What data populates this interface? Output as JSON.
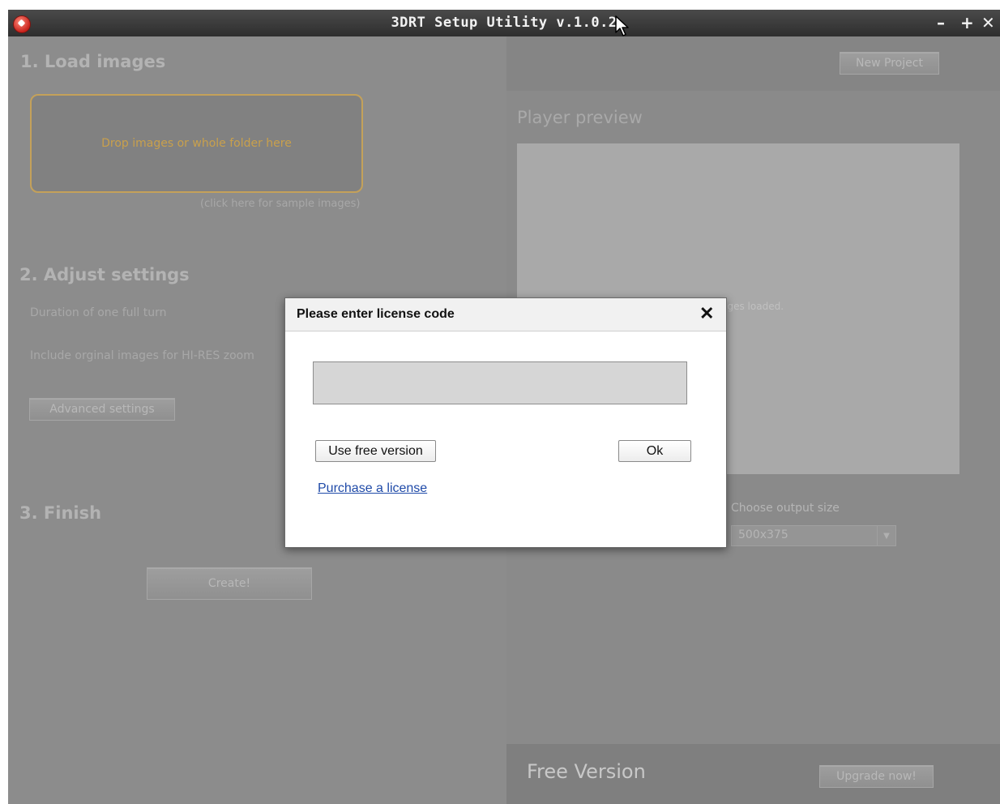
{
  "window": {
    "title": "3DRT Setup Utility v.1.0.2",
    "controls": {
      "minimize": "–",
      "maximize": "+",
      "close": "✕"
    }
  },
  "left": {
    "section1_title": "1. Load images",
    "drop_zone_text": "Drop images or whole folder here",
    "sample_link": "(click here for sample images)",
    "section2_title": "2. Adjust settings",
    "duration_label": "Duration of one full turn",
    "include_label": "Include orginal images for HI-RES zoom",
    "advanced_button": "Advanced settings",
    "section3_title": "3. Finish",
    "create_button": "Create!"
  },
  "right": {
    "new_project_button": "New Project",
    "preview_title": "Player preview",
    "preview_status": "No images loaded.",
    "output_size_label": "Choose output size",
    "output_size_value": "500x375",
    "free_version_label": "Free Version",
    "upgrade_button": "Upgrade now!"
  },
  "dialog": {
    "title": "Please enter license code",
    "close": "✕",
    "input_value": "",
    "free_button": "Use free version",
    "ok_button": "Ok",
    "purchase_link": "Purchase a license"
  },
  "colors": {
    "overlay_gray": "#8c8c8c",
    "accent_border": "#c4a15a",
    "link": "#1f4aa8"
  }
}
